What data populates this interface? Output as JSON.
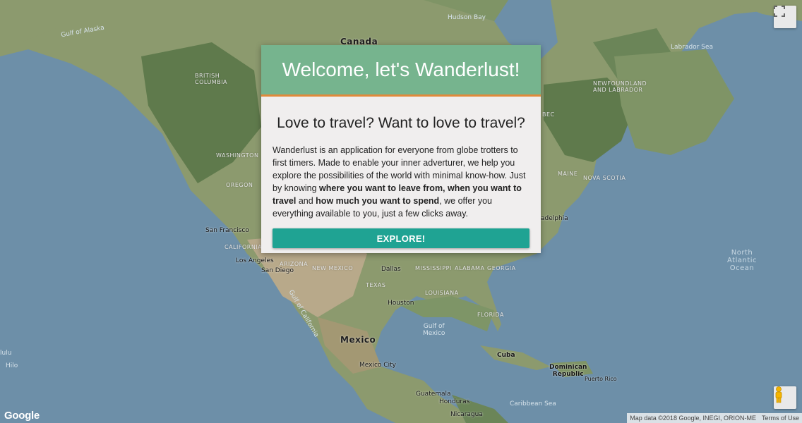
{
  "map": {
    "labels": {
      "hudson_bay": "Hudson Bay",
      "gulf_of_alaska": "Gulf of Alaska",
      "labrador_sea": "Labrador Sea",
      "canada": "Canada",
      "british_columbia": "BRITISH\nCOLUMBIA",
      "newfoundland": "NEWFOUNDLAND\nAND LABRADOR",
      "quebec": "BEC",
      "washington": "WASHINGTON",
      "oregon": "OREGON",
      "maine": "MAINE",
      "nova_scotia": "NOVA SCOTIA",
      "philadelphia": "adelphia",
      "san_francisco": "San Francisco",
      "california": "CALIFORNIA",
      "los_angeles": "Los Angeles",
      "san_diego": "San Diego",
      "arizona": "ARIZONA",
      "new_mexico": "NEW MEXICO",
      "dallas": "Dallas",
      "mississippi": "MISSISSIPPI",
      "alabama": "ALABAMA",
      "georgia": "GEORGIA",
      "texas": "TEXAS",
      "louisiana": "LOUISIANA",
      "houston": "Houston",
      "florida": "FLORIDA",
      "north_atlantic": "North\nAtlantic\nOcean",
      "gulf_of_california": "Gulf of California",
      "gulf_of_mexico": "Gulf of\nMexico",
      "mexico": "Mexico",
      "mexico_city": "Mexico City",
      "cuba": "Cuba",
      "dominican_republic": "Dominican\nRepublic",
      "puerto_rico": "Puerto Rico",
      "guatemala": "Guatemala",
      "honduras": "Honduras",
      "nicaragua": "Nicaragua",
      "caribbean_sea": "Caribbean Sea",
      "hawaii_fragment_1": "lulu",
      "hawaii_fragment_2": "Hilo"
    },
    "google_logo": "Google",
    "attribution": "Map data ©2018 Google, INEGI, ORION-ME",
    "terms_link": "Terms of Use",
    "colors": {
      "water": "#6d8fa8",
      "land": "#8c9a6e",
      "forest": "#5f7a4c",
      "desert": "#b8a98a"
    }
  },
  "modal": {
    "title": "Welcome, let's Wanderlust!",
    "subtitle": "Love to travel? Want to love to travel?",
    "paragraph": {
      "part1": "Wanderlust is an application for everyone from globe trotters to first timers. Made to enable your inner adverturer, we help you explore the possibilities of the world with minimal know-how. Just by knowing ",
      "bold1": "where you want to leave from, when you want to travel",
      "part2": " and ",
      "bold2": "how much you want to spend",
      "part3": ", we offer you everything available to you, just a few clicks away."
    },
    "explore_label": "EXPLORE!",
    "colors": {
      "header": "#76b48e",
      "accent_line": "#e08a3b",
      "button": "#1fa393",
      "body": "#f0eeee"
    }
  }
}
